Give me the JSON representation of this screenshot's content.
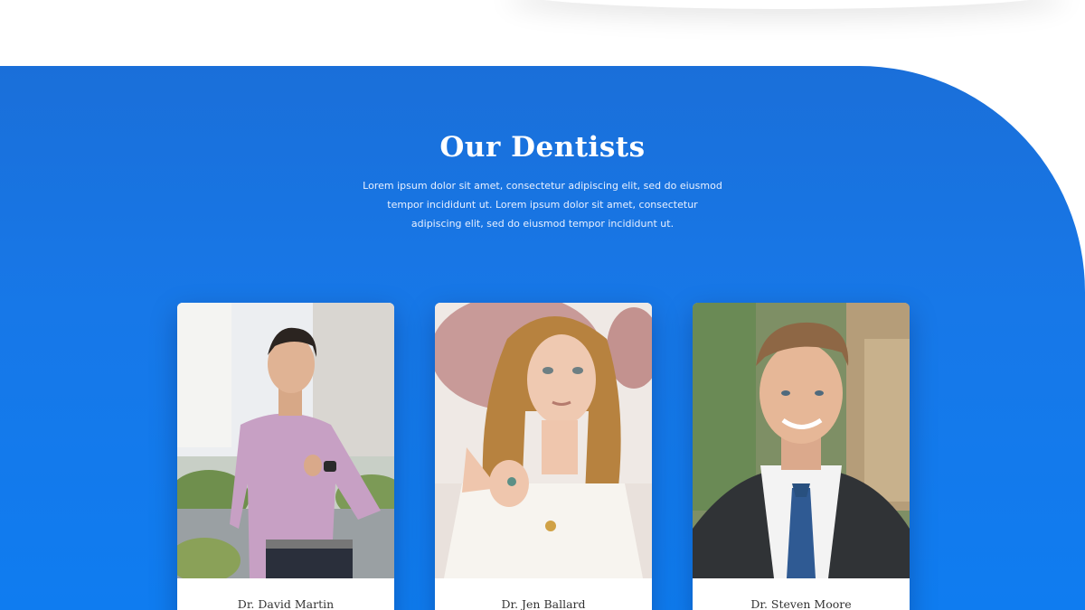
{
  "section": {
    "title": "Our Dentists",
    "description": "Lorem ipsum dolor sit amet, consectetur adipiscing elit, sed do eiusmod tempor incididunt ut. Lorem ipsum dolor sit amet, consectetur adipiscing elit, sed do eiusmod tempor incididunt ut."
  },
  "dentists": [
    {
      "name": "Dr. David Martin"
    },
    {
      "name": "Dr. Jen Ballard"
    },
    {
      "name": "Dr. Steven Moore"
    }
  ],
  "colors": {
    "section_blue": "#1778e8",
    "card_bg": "#ffffff",
    "title_text": "#ffffff",
    "name_text": "#333333"
  }
}
